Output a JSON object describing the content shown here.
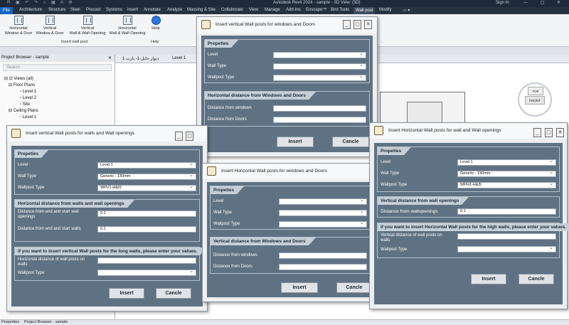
{
  "app": {
    "title": "Autodesk Revit 2024 - sample - 3D View: {3D}",
    "signin": "Sign In"
  },
  "menu": [
    "File",
    "Architecture",
    "Structure",
    "Steel",
    "Precast",
    "Systems",
    "Insert",
    "Annotate",
    "Analyze",
    "Massing & Site",
    "Collaborate",
    "View",
    "Manage",
    "Add-Ins",
    "Enscape™",
    "Bird Tools",
    "Wall post",
    "Modify"
  ],
  "ribbon": {
    "buttons": [
      {
        "label1": "Horizontal",
        "label2": "Window & Door"
      },
      {
        "label1": "Vertical",
        "label2": "Window & Door"
      },
      {
        "label1": "Vertical",
        "label2": "Wall & Wall Opening"
      },
      {
        "label1": "Horizontal",
        "label2": "Wall & Wall Opening"
      },
      {
        "label1": "Help",
        "label2": ""
      }
    ],
    "group1": "Insert wall post",
    "group2": "Help"
  },
  "browser": {
    "title": "Project Browser - sample",
    "search": "Search",
    "tree": [
      "Views (all)",
      "Floor Plans",
      "Level 1",
      "Level 2",
      "Site",
      "Ceiling Plans",
      "Level 1"
    ]
  },
  "viewtabs": {
    "tab1": "دیوار حایل-1- بارت 1",
    "tab2": "Level 1"
  },
  "viewcube": {
    "top": "TOP",
    "front": "FRONT"
  },
  "status": {
    "left": "Properties",
    "right": "Project Browser - sample"
  },
  "dialog_vwd": {
    "title": "Insert vertical  Wall posts  for windows and Doors",
    "props_title": "Propeties",
    "level_label": "Level",
    "level_value": "",
    "walltype_label": "Wall Type",
    "walltype_value": "",
    "posttype_label": "Wallpost Type",
    "posttype_value": "",
    "dist_title": "Horizontal distance from Windows and Doors",
    "win_label": "Distance from windows",
    "win_value": "",
    "door_label": "Distance from Doors",
    "door_value": "",
    "insert": "Insert",
    "cancel": "Cancle"
  },
  "dialog_vwo": {
    "title": "Insert vertical  Wall posts for walls and Wall openings",
    "props_title": "Propeties",
    "level_label": "Level",
    "level_value": "Level 1",
    "walltype_label": "Wall Type",
    "walltype_value": "Generic - 150mm",
    "posttype_label": "Wallpost Type",
    "posttype_value": "WPV1-H&I5",
    "dist_title": "Horizontal distance from  walls and wall openings",
    "d1_label": "Distance from end and start wall openings",
    "d1_value": "0.1",
    "d2_label": "Distance from end and start walls",
    "d2_value": "0.1",
    "long_title": "if you want to insert vertical Wall posts for the long walls, please enter your values.",
    "h_label": "Horizontal distance of wall posts on walls",
    "h_value": "",
    "lp_label": "Wallpost Type",
    "lp_value": "",
    "insert": "Insert",
    "cancel": "Cancle"
  },
  "dialog_hwd": {
    "title": "Insert Horizontal  Wall posts  for windows and Doors",
    "props_title": "Propeties",
    "level_label": "Level",
    "level_value": "",
    "walltype_label": "Wall Type",
    "walltype_value": "",
    "posttype_label": "Wallpost Type",
    "posttype_value": "",
    "dist_title": "Vertical distance from Windows and Doors",
    "win_label": "Distance from windows",
    "win_value": "",
    "door_label": "Distance from Doors",
    "door_value": "",
    "insert": "Insert",
    "cancel": "Cancle"
  },
  "dialog_hwo": {
    "title": "Insert Horizontal  Wall posts for wall and Wall openings",
    "props_title": "Propeties",
    "level_label": "Level",
    "level_value": "Level 1",
    "walltype_label": "Wall Type",
    "walltype_value": "Generic - 150mm",
    "posttype_label": "Wallpost Type",
    "posttype_value": "WPH1-H&I5",
    "dist_title": "Vertical distance from wall openings",
    "d_label": "Distance from wallopenings",
    "d_value": "0.1",
    "high_title": "if you want to insert Horizontal Wall posts for the high walls, please enter your values.",
    "v_label": "Vertical distance of wall posts on walls",
    "v_value": "",
    "hp_label": "Wallpost Type",
    "hp_value": "",
    "insert": "Insert",
    "cancel": "Cancle"
  }
}
